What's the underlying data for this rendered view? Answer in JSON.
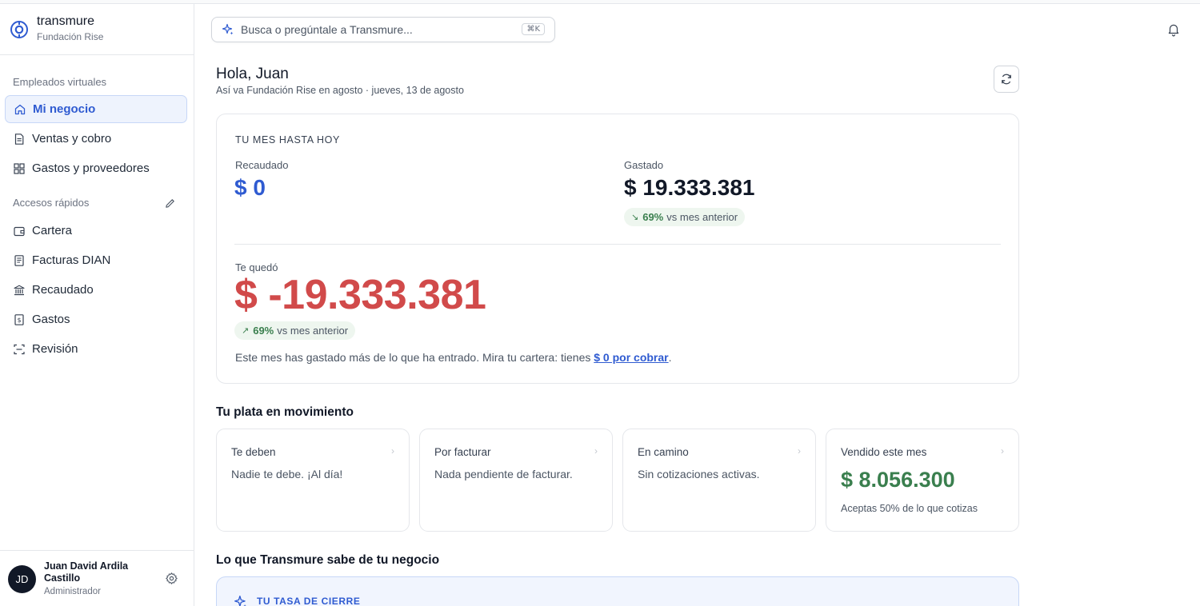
{
  "brand": {
    "name": "transmure",
    "org": "Fundación Rise"
  },
  "sidebar": {
    "section1": "Empleados virtuales",
    "main_items": [
      {
        "label": "Mi negocio",
        "icon": "home-icon",
        "active": true
      },
      {
        "label": "Ventas y cobro",
        "icon": "document-icon"
      },
      {
        "label": "Gastos y proveedores",
        "icon": "grid-icon"
      }
    ],
    "section2": "Accesos rápidos",
    "quick_items": [
      {
        "label": "Cartera",
        "icon": "wallet-icon"
      },
      {
        "label": "Facturas DIAN",
        "icon": "invoice-icon"
      },
      {
        "label": "Recaudado",
        "icon": "bank-icon"
      },
      {
        "label": "Gastos",
        "icon": "receipt-dollar-icon"
      },
      {
        "label": "Revisión",
        "icon": "scan-icon"
      }
    ]
  },
  "user": {
    "initials": "JD",
    "name": "Juan David Ardila Castillo",
    "role": "Administrador"
  },
  "search": {
    "placeholder": "Busca o pregúntale a Transmure...",
    "shortcut": "⌘K"
  },
  "greeting": {
    "title": "Hola, Juan",
    "subtitle": "Así va Fundación Rise en agosto · jueves, 13 de agosto"
  },
  "month_card": {
    "title": "TU MES HASTA HOY",
    "collected_label": "Recaudado",
    "collected_value": "$ 0",
    "spent_label": "Gastado",
    "spent_value": "$ 19.333.381",
    "spent_change": "69%",
    "spent_change_text": "vs mes anterior",
    "left_label": "Te quedó",
    "left_value": "$ -19.333.381",
    "left_change": "69%",
    "left_change_text": "vs mes anterior",
    "note_prefix": "Este mes has gastado más de lo que ha entrado. Mira tu cartera: tienes ",
    "note_link": "$ 0 por cobrar",
    "note_suffix": "."
  },
  "movement": {
    "title": "Tu plata en movimiento",
    "cards": [
      {
        "title": "Te deben",
        "desc": "Nadie te debe. ¡Al día!"
      },
      {
        "title": "Por facturar",
        "desc": "Nada pendiente de facturar."
      },
      {
        "title": "En camino",
        "desc": "Sin cotizaciones activas."
      },
      {
        "title": "Vendido este mes",
        "value": "$ 8.056.300",
        "sub": "Aceptas 50% de lo que cotizas"
      }
    ]
  },
  "knowledge": {
    "title": "Lo que Transmure sabe de tu negocio",
    "insight_title": "TU TASA DE CIERRE"
  },
  "colors": {
    "accent": "#2f5bd1",
    "negative": "#d14a4a",
    "positive": "#3a7f4e"
  }
}
